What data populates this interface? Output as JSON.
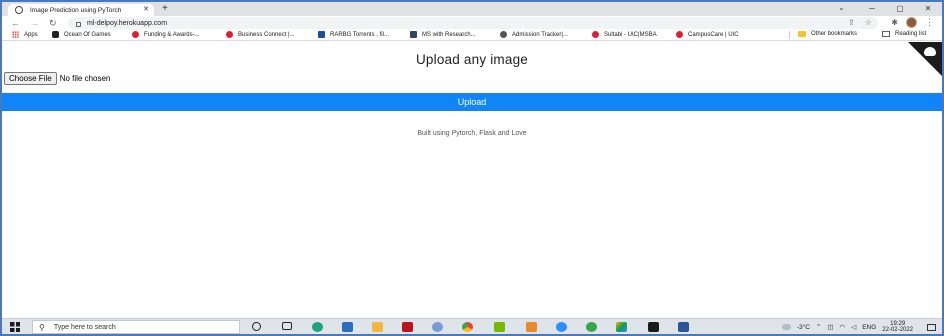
{
  "browser": {
    "tab_title": "Image Prediction using PyTorch",
    "tab_close": "✕",
    "new_tab": "+",
    "url": "ml-delpoy.herokuapp.com",
    "window_controls": [
      "─",
      "▢",
      "✕"
    ],
    "tab_search": "⌄"
  },
  "bookmarks": {
    "items": [
      {
        "label": "Apps",
        "icon": "apps-grid-icon"
      },
      {
        "label": "Ocean Of Games",
        "icon": "gamepad-icon"
      },
      {
        "label": "Funding & Awards-...",
        "icon": "uic-icon"
      },
      {
        "label": "Business Connect |...",
        "icon": "uic-icon"
      },
      {
        "label": "RARBG Torrents , fil...",
        "icon": "rarbg-icon"
      },
      {
        "label": "MS with Research...",
        "icon": "ms-icon"
      },
      {
        "label": "Admission Tracker|...",
        "icon": "tracker-icon"
      },
      {
        "label": "Sultabi - UIC|MSBA",
        "icon": "uic-icon"
      },
      {
        "label": "CampusCare | UIC",
        "icon": "uic-icon"
      }
    ],
    "other": "Other bookmarks",
    "reading_list": "Reading list"
  },
  "page": {
    "title": "Upload any image",
    "choose_file": "Choose File",
    "file_status": "No file chosen",
    "upload_label": "Upload",
    "footer": "Built using Pytorch, Flask and Love"
  },
  "taskbar": {
    "search_placeholder": "Type here to search",
    "weather": "-3°C",
    "language": "ENG",
    "time": "19:29",
    "date": "22-02-2022"
  },
  "colors": {
    "upload_bar": "#1185f7",
    "corner": "#1c1c1c"
  }
}
